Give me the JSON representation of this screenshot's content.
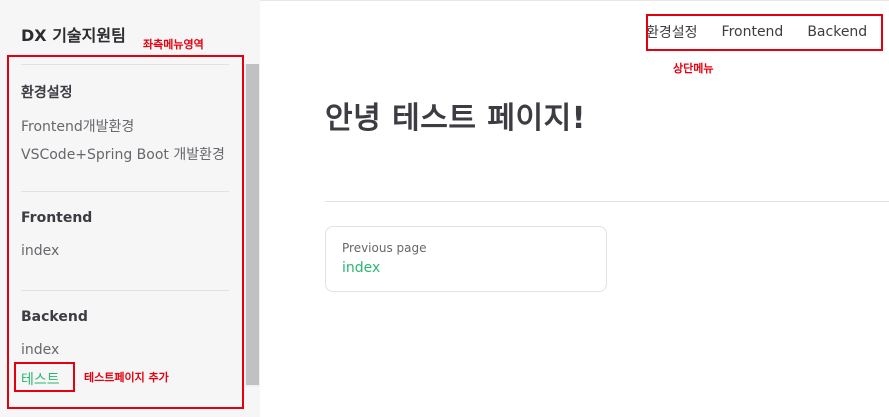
{
  "sidebar": {
    "title": "DX 기술지원팀",
    "sections": [
      {
        "heading": "환경설정",
        "links": [
          "Frontend개발환경",
          "VSCode+Spring Boot 개발환경"
        ]
      },
      {
        "heading": "Frontend",
        "links": [
          "index"
        ]
      },
      {
        "heading": "Backend",
        "links": [
          "index",
          "테스트"
        ]
      }
    ],
    "active_link": "테스트"
  },
  "topnav": {
    "items": [
      "환경설정",
      "Frontend",
      "Backend"
    ]
  },
  "main": {
    "title": "안녕 테스트 페이지!",
    "prev": {
      "label": "Previous page",
      "link": "index"
    }
  },
  "annotations": {
    "left_menu": "좌측메뉴영역",
    "top_menu": "상단메뉴",
    "test_page": "테스트페이지 추가",
    "color": "#e5000f"
  },
  "colors": {
    "accent": "#2bb673",
    "sidebar_bg": "#f6f6f7",
    "text": "#3c3c43"
  }
}
